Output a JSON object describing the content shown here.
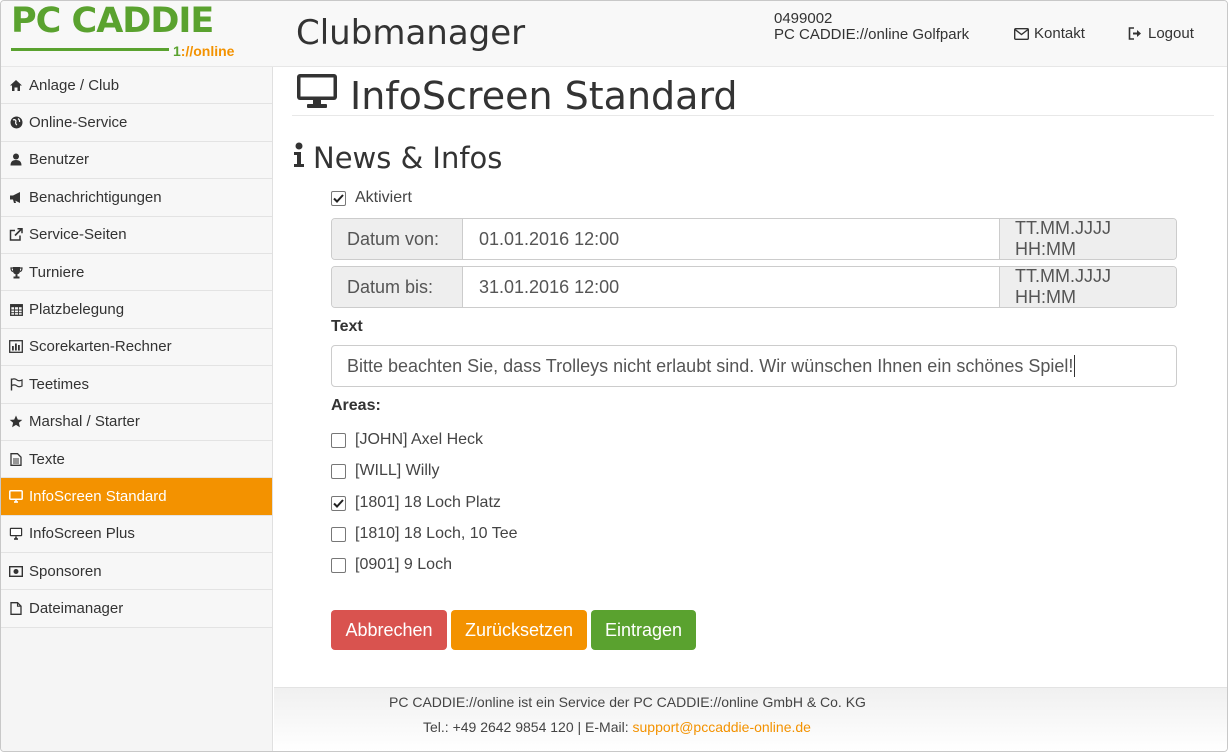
{
  "header": {
    "logo_brand": "PC CADDIE",
    "logo_sub_one": "1",
    "logo_sub": "://online",
    "app_title": "Clubmanager",
    "club_number": "0499002",
    "club_name": "PC CADDIE://online Golfpark",
    "contact_label": "Kontakt",
    "logout_label": "Logout"
  },
  "sidebar": {
    "items": [
      {
        "label": "Anlage / Club",
        "icon": "home-icon"
      },
      {
        "label": "Online-Service",
        "icon": "globe-icon"
      },
      {
        "label": "Benutzer",
        "icon": "user-icon"
      },
      {
        "label": "Benachrichtigungen",
        "icon": "bullhorn-icon"
      },
      {
        "label": "Service-Seiten",
        "icon": "external-link-icon"
      },
      {
        "label": "Turniere",
        "icon": "trophy-icon"
      },
      {
        "label": "Platzbelegung",
        "icon": "calendar-icon"
      },
      {
        "label": "Scorekarten-Rechner",
        "icon": "bar-chart-icon"
      },
      {
        "label": "Teetimes",
        "icon": "flag-icon"
      },
      {
        "label": "Marshal / Starter",
        "icon": "star-icon"
      },
      {
        "label": "Texte",
        "icon": "document-icon"
      },
      {
        "label": "InfoScreen Standard",
        "icon": "monitor-icon",
        "active": true
      },
      {
        "label": "InfoScreen Plus",
        "icon": "monitor-icon"
      },
      {
        "label": "Sponsoren",
        "icon": "money-icon"
      },
      {
        "label": "Dateimanager",
        "icon": "file-icon"
      }
    ]
  },
  "main": {
    "page_title": "InfoScreen Standard",
    "section_title": "News & Infos",
    "activated_label": "Aktiviert",
    "activated_checked": true,
    "date_from_label": "Datum von:",
    "date_from_value": "01.01.2016 12:00",
    "date_from_format": "TT.MM.JJJJ HH:MM",
    "date_to_label": "Datum bis:",
    "date_to_value": "31.01.2016 12:00",
    "date_to_format": "TT.MM.JJJJ HH:MM",
    "text_label": "Text",
    "text_value": "Bitte beachten Sie, dass Trolleys nicht erlaubt sind. Wir wünschen Ihnen ein schönes Spiel!",
    "areas_label": "Areas:",
    "areas": [
      {
        "label": "[JOHN] Axel Heck",
        "checked": false
      },
      {
        "label": "[WILL] Willy",
        "checked": false
      },
      {
        "label": "[1801] 18 Loch Platz",
        "checked": true
      },
      {
        "label": "[1810] 18 Loch, 10 Tee",
        "checked": false
      },
      {
        "label": "[0901] 9 Loch",
        "checked": false
      }
    ],
    "buttons": {
      "cancel": "Abbrechen",
      "reset": "Zurücksetzen",
      "submit": "Eintragen"
    }
  },
  "footer": {
    "line1": "PC CADDIE://online ist ein Service der PC CADDIE://online GmbH & Co. KG",
    "line2_prefix": "Tel.: +49 2642 9854 120 | E-Mail: ",
    "email": "support@pccaddie-online.de"
  },
  "colors": {
    "brand_green": "#5aa22f",
    "accent_orange": "#f39200",
    "danger_red": "#d9534f"
  }
}
